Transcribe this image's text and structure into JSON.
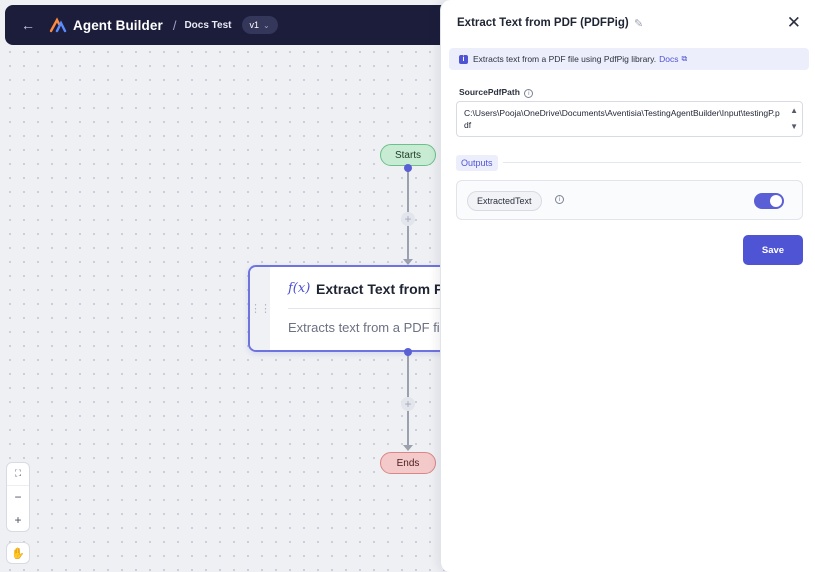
{
  "header": {
    "back_icon": "arrow-left-icon",
    "brand": "Agent Builder",
    "separator": "/",
    "breadcrumb": "Docs Test",
    "version": "v1"
  },
  "canvas": {
    "start_label": "Starts",
    "end_label": "Ends",
    "function_node": {
      "icon": "f(x)",
      "title": "Extract Text from PDF (PDFPig)",
      "description": "Extracts text from a PDF file using PdfPig library."
    },
    "controls": [
      "fit-view-icon",
      "zoom-out-icon",
      "zoom-in-icon",
      "hand-icon"
    ]
  },
  "panel": {
    "title": "Extract Text from PDF (PDFPig)",
    "info_text": "Extracts text from a PDF file using PdfPig library.",
    "docs_link": "Docs",
    "source_label": "SourcePdfPath",
    "source_value": "C:\\Users\\Pooja\\OneDrive\\Documents\\Aventisia\\TestingAgentBuilder\\Input\\testingP.pdf",
    "outputs_label": "Outputs",
    "output_name": "ExtractedText",
    "output_enabled": true,
    "save_label": "Save"
  },
  "colors": {
    "accent": "#4f54d4",
    "header_bg": "#1c1d3b",
    "start_bg": "#c7ecd3",
    "end_bg": "#f4c9c9"
  }
}
